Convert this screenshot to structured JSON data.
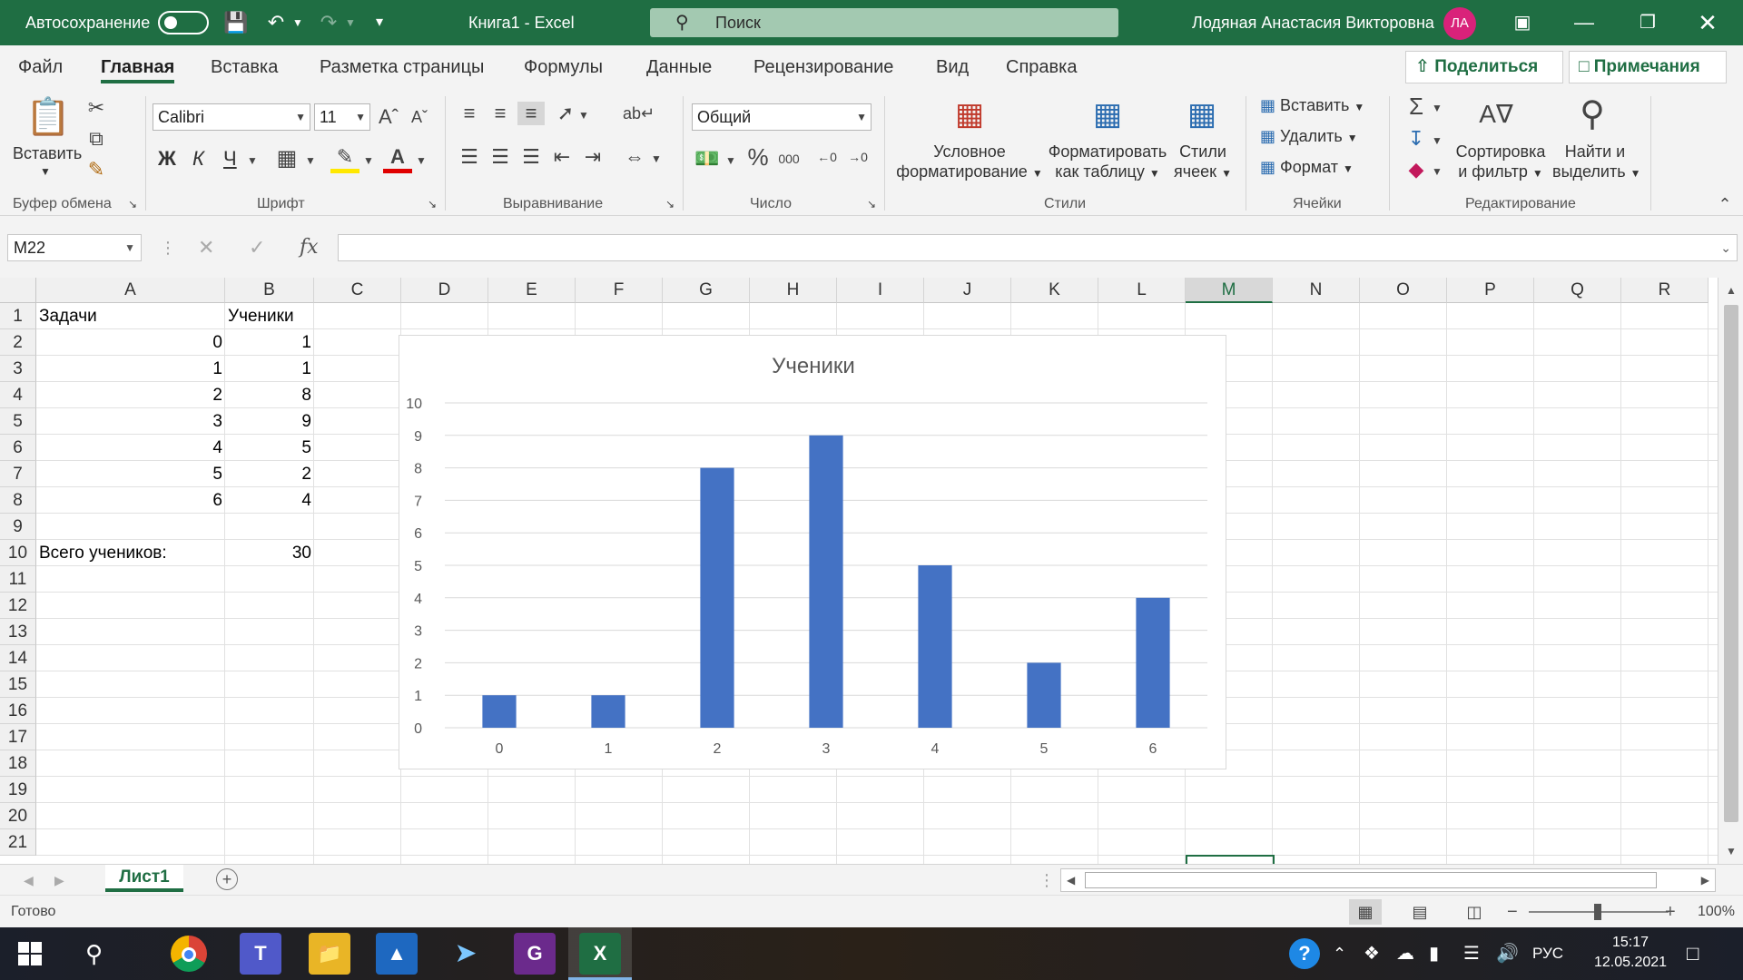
{
  "titlebar": {
    "autosave_label": "Автосохранение",
    "document_title": "Книга1  -  Excel",
    "search_placeholder": "Поиск",
    "user_name": "Лодяная Анастасия Викторовна",
    "user_initials": "ЛА"
  },
  "tabs": [
    "Файл",
    "Главная",
    "Вставка",
    "Разметка страницы",
    "Формулы",
    "Данные",
    "Рецензирование",
    "Вид",
    "Справка"
  ],
  "active_tab": "Главная",
  "share": {
    "share_label": "Поделиться",
    "comments_label": "Примечания"
  },
  "ribbon": {
    "clipboard": {
      "paste_label": "Вставить",
      "group_label": "Буфер обмена"
    },
    "font": {
      "font_name": "Calibri",
      "font_size": "11",
      "bold": "Ж",
      "italic": "К",
      "underline": "Ч",
      "group_label": "Шрифт"
    },
    "alignment": {
      "group_label": "Выравнивание"
    },
    "number": {
      "format": "Общий",
      "group_label": "Число"
    },
    "styles": {
      "conditional_line1": "Условное",
      "conditional_line2": "форматирование",
      "table_line1": "Форматировать",
      "table_line2": "как таблицу",
      "cellstyles_line1": "Стили",
      "cellstyles_line2": "ячеек",
      "group_label": "Стили"
    },
    "cells": {
      "insert": "Вставить",
      "delete": "Удалить",
      "format": "Формат",
      "group_label": "Ячейки"
    },
    "editing": {
      "sort_line1": "Сортировка",
      "sort_line2": "и фильтр",
      "find_line1": "Найти и",
      "find_line2": "выделить",
      "group_label": "Редактирование"
    }
  },
  "formula_bar": {
    "name_box": "M22",
    "formula": ""
  },
  "columns": [
    "A",
    "B",
    "C",
    "D",
    "E",
    "F",
    "G",
    "H",
    "I",
    "J",
    "K",
    "L",
    "M",
    "N",
    "O",
    "P",
    "Q",
    "R"
  ],
  "selected_column": "M",
  "rows": [
    "1",
    "2",
    "3",
    "4",
    "5",
    "6",
    "7",
    "8",
    "9",
    "10",
    "11",
    "12",
    "13",
    "14",
    "15",
    "16",
    "17",
    "18",
    "19",
    "20",
    "21"
  ],
  "cells": {
    "A1": "Задачи",
    "B1": "Ученики",
    "A2": "0",
    "B2": "1",
    "A3": "1",
    "B3": "1",
    "A4": "2",
    "B4": "8",
    "A5": "3",
    "B5": "9",
    "A6": "4",
    "B6": "5",
    "A7": "5",
    "B7": "2",
    "A8": "6",
    "B8": "4",
    "A10": "Всего учеников:",
    "B10": "30"
  },
  "chart_data": {
    "type": "bar",
    "title": "Ученики",
    "categories": [
      "0",
      "1",
      "2",
      "3",
      "4",
      "5",
      "6"
    ],
    "values": [
      1,
      1,
      8,
      9,
      5,
      2,
      4
    ],
    "ylim": [
      0,
      10
    ],
    "yticks": [
      "0",
      "1",
      "2",
      "3",
      "4",
      "5",
      "6",
      "7",
      "8",
      "9",
      "10"
    ],
    "grid": true,
    "legend": "none",
    "bar_color": "#4472c4"
  },
  "sheets": {
    "active_sheet": "Лист1"
  },
  "status": {
    "ready": "Готово",
    "zoom": "100%"
  },
  "taskbar": {
    "lang": "РУС",
    "time": "15:17",
    "date": "12.05.2021"
  },
  "colors": {
    "excel_green": "#1f6e43",
    "avatar": "#d9227a"
  }
}
